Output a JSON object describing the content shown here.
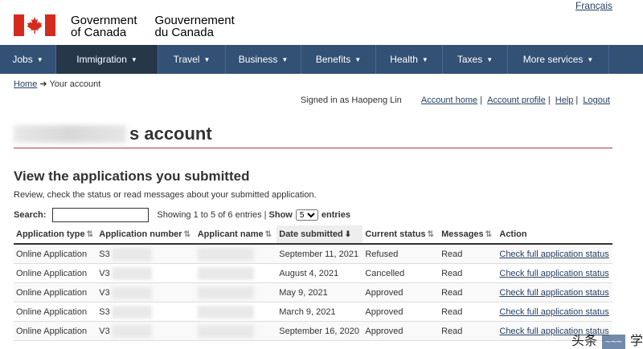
{
  "lang_toggle": "Français",
  "brand": {
    "en_line1": "Government",
    "en_line2": "of Canada",
    "fr_line1": "Gouvernement",
    "fr_line2": "du Canada"
  },
  "nav": [
    {
      "label": "Jobs",
      "width": 70
    },
    {
      "label": "Immigration",
      "width": 127,
      "active": true
    },
    {
      "label": "Travel",
      "width": 84
    },
    {
      "label": "Business",
      "width": 94
    },
    {
      "label": "Benefits",
      "width": 93
    },
    {
      "label": "Health",
      "width": 83
    },
    {
      "label": "Taxes",
      "width": 81
    },
    {
      "label": "More services",
      "width": 126
    }
  ],
  "breadcrumb": {
    "home": "Home",
    "arrow": "➜",
    "current": "Your account"
  },
  "account_bar": {
    "signed_in": "Signed in as Haopeng Lin",
    "home": "Account home",
    "profile": "Account profile",
    "help": "Help",
    "logout": "Logout"
  },
  "page_title_suffix": "s account",
  "section_title": "View the applications you submitted",
  "description": "Review, check the status or read messages about your submitted application.",
  "table_controls": {
    "search_label": "Search:",
    "showing": "Showing 1 to 5 of 6 entries |",
    "show_label": "Show",
    "page_size": "5",
    "entries_label": "entries"
  },
  "table": {
    "headers": [
      "Application type",
      "Application number",
      "Applicant name",
      "Date submitted",
      "Current status",
      "Messages",
      "Action"
    ],
    "rows": [
      {
        "type": "Online Application",
        "number": "S3",
        "date": "September 11, 2021",
        "status": "Refused",
        "messages": "Read",
        "action": "Check full application status"
      },
      {
        "type": "Online Application",
        "number": "V3",
        "date": "August 4, 2021",
        "status": "Cancelled",
        "messages": "Read",
        "action": "Check full application status"
      },
      {
        "type": "Online Application",
        "number": "V3",
        "date": "May 9, 2021",
        "status": "Approved",
        "messages": "Read",
        "action": "Check full application status"
      },
      {
        "type": "Online Application",
        "number": "S3",
        "date": "March 9, 2021",
        "status": "Approved",
        "messages": "Read",
        "action": "Check full application status"
      },
      {
        "type": "Online Application",
        "number": "V3",
        "date": "September 16, 2020",
        "status": "Approved",
        "messages": "Read",
        "action": "Check full application status"
      }
    ]
  },
  "watermark": {
    "text1": "头条",
    "text2": "学"
  }
}
